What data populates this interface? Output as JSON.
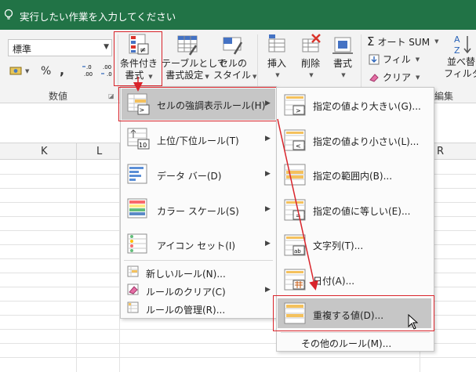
{
  "tellme": {
    "text": "実行したい作業を入力してください"
  },
  "ribbon": {
    "number_format": "標準",
    "percent": "%",
    "comma": ",",
    "currency": "🅂",
    "inc_decimal": "←.0 .00",
    "dec_decimal": ".00 →.0",
    "group_number": "数値",
    "cond_format": [
      "条件付き",
      "書式"
    ],
    "table_format": [
      "テーブルとして",
      "書式設定"
    ],
    "cell_style": [
      "セルの",
      "スタイル"
    ],
    "insert": "挿入",
    "delete": "削除",
    "format": "書式",
    "autosum": "オート SUM",
    "fill": "フィル",
    "clear": "クリア",
    "sort": [
      "並べ替",
      "フィルター"
    ],
    "group_edit": "編集"
  },
  "columns": [
    "K",
    "L",
    "R"
  ],
  "menu_main": {
    "items": [
      "セルの強調表示ルール(H)",
      "上位/下位ルール(T)",
      "データ バー(D)",
      "カラー スケール(S)",
      "アイコン セット(I)",
      "新しいルール(N)...",
      "ルールのクリア(C)",
      "ルールの管理(R)..."
    ]
  },
  "menu_sub": {
    "items": [
      "指定の値より大きい(G)...",
      "指定の値より小さい(L)...",
      "指定の範囲内(B)...",
      "指定の値に等しい(E)...",
      "文字列(T)...",
      "日付(A)...",
      "重複する値(D)...",
      "その他のルール(M)..."
    ]
  },
  "colors": {
    "excel_green": "#217346",
    "highlight": "#c6c6c6",
    "callout_red": "#d9242b"
  }
}
